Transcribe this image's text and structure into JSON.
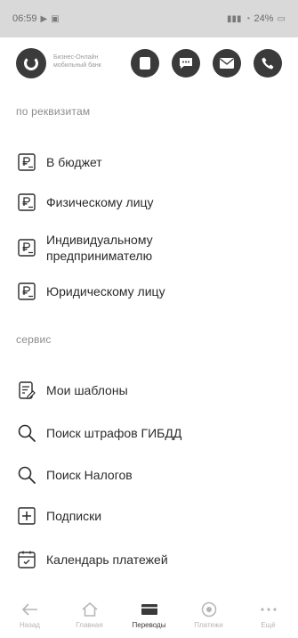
{
  "status_bar": {
    "time": "06:59",
    "right_text": "24%"
  },
  "header": {
    "brand_text_line1": "Бизнес-Онлайн",
    "brand_text_line2": "мобильный банк",
    "icons": [
      "card-icon",
      "chat-icon",
      "mail-icon",
      "phone-icon"
    ]
  },
  "sections": {
    "requisites": {
      "title": "по реквизитам",
      "items": [
        {
          "label": "В бюджет",
          "icon": "ruble-document-icon"
        },
        {
          "label": "Физическому лицу",
          "icon": "ruble-document-icon"
        },
        {
          "label": "Индивидуальному",
          "label_2": "предпринимателю",
          "icon": "ruble-document-icon"
        },
        {
          "label": "Юридическому лицу",
          "icon": "ruble-document-icon"
        }
      ]
    },
    "service": {
      "title": "сервис",
      "items": [
        {
          "label": "Мои шаблоны",
          "icon": "edit-document-icon"
        },
        {
          "label": "Поиск штрафов ГИБДД",
          "icon": "search-icon"
        },
        {
          "label": "Поиск Налогов",
          "icon": "search-icon"
        },
        {
          "label": "Подписки",
          "icon": "plus-box-icon"
        },
        {
          "label": "Календарь платежей",
          "icon": "calendar-icon"
        }
      ]
    }
  },
  "bottom_nav": {
    "items": [
      {
        "label": "Назад",
        "icon": "back-icon",
        "active": false
      },
      {
        "label": "Главная",
        "icon": "home-icon",
        "active": false
      },
      {
        "label": "Переводы",
        "icon": "transfer-icon",
        "active": true
      },
      {
        "label": "Платежи",
        "icon": "payments-icon",
        "active": false
      },
      {
        "label": "Ещё",
        "icon": "more-icon",
        "active": false
      }
    ]
  },
  "colors": {
    "accent_dark": "#3a3a3a",
    "section_title": "#8c8c8c",
    "text": "#2b2b2b"
  }
}
